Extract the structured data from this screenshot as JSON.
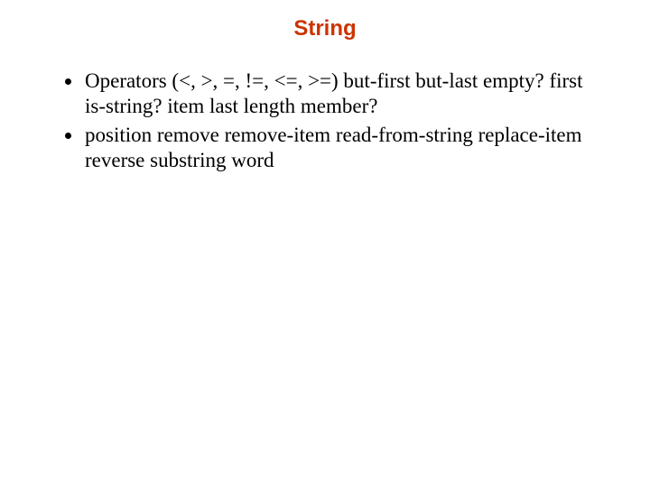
{
  "title": "String",
  "bullets": [
    "Operators (<, >, =, !=, <=, >=) but-first but-last empty? first is-string? item last length member?",
    "position remove remove-item read-from-string replace-item reverse substring word"
  ]
}
